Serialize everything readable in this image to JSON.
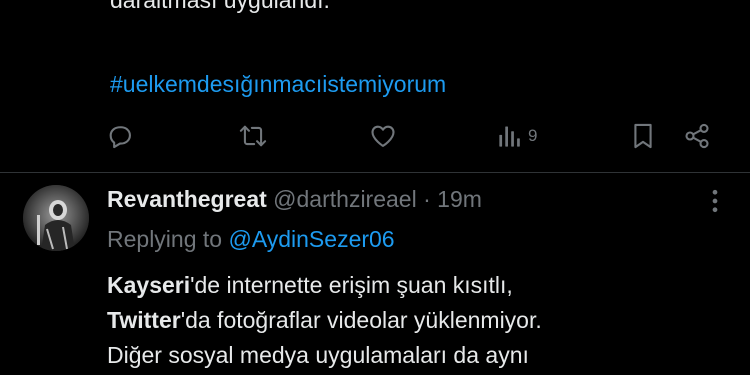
{
  "previous_tweet": {
    "text_tail": "daraltması uygulandı.",
    "hashtag": "#uelkemdesığınmacıistemiyorum",
    "actions": {
      "reply_icon": "comment-icon",
      "retweet_icon": "retweet-icon",
      "like_icon": "heart-icon",
      "views_icon": "views-bar-chart-icon",
      "views_count": "9",
      "bookmark_icon": "bookmark-icon",
      "share_icon": "share-icon"
    }
  },
  "reply": {
    "display_name": "Revanthegreat",
    "handle": "@darthzireael",
    "separator": "·",
    "time": "19m",
    "replying_prefix": "Replying to",
    "replying_to": "@AydinSezer06",
    "more_icon": "more-options-icon",
    "lines": [
      {
        "bold": "Kayseri",
        "rest": "'de internette erişim şuan kısıtlı,"
      },
      {
        "bold": "Twitter",
        "rest": "'da fotoğraflar videolar yüklenmiyor."
      },
      {
        "bold": "",
        "rest": "Diğer sosyal medya uygulamaları da aynı"
      }
    ]
  },
  "colors": {
    "background": "#000000",
    "text": "#e7e9ea",
    "muted": "#71767b",
    "link": "#1d9bf0",
    "divider": "#2f3336"
  }
}
